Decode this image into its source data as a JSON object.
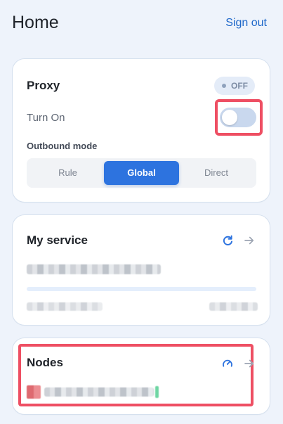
{
  "header": {
    "title": "Home",
    "sign_out_label": "Sign out"
  },
  "proxy": {
    "title": "Proxy",
    "status_badge": "OFF",
    "turn_on_label": "Turn On",
    "toggle_enabled": false,
    "outbound_mode_label": "Outbound mode",
    "outbound_modes": [
      {
        "label": "Rule",
        "selected": false
      },
      {
        "label": "Global",
        "selected": true
      },
      {
        "label": "Direct",
        "selected": false
      }
    ]
  },
  "service": {
    "title": "My service",
    "usage_progress": 0
  },
  "nodes": {
    "title": "Nodes"
  },
  "colors": {
    "accent": "#2d73df",
    "link": "#1d67c9",
    "highlight": "#ee4f63",
    "page_background": "#eef3fb"
  },
  "icons": {
    "refresh": "refresh-icon",
    "arrow_right": "arrow-right-icon",
    "speed": "speed-icon",
    "status_dot": "status-dot"
  }
}
